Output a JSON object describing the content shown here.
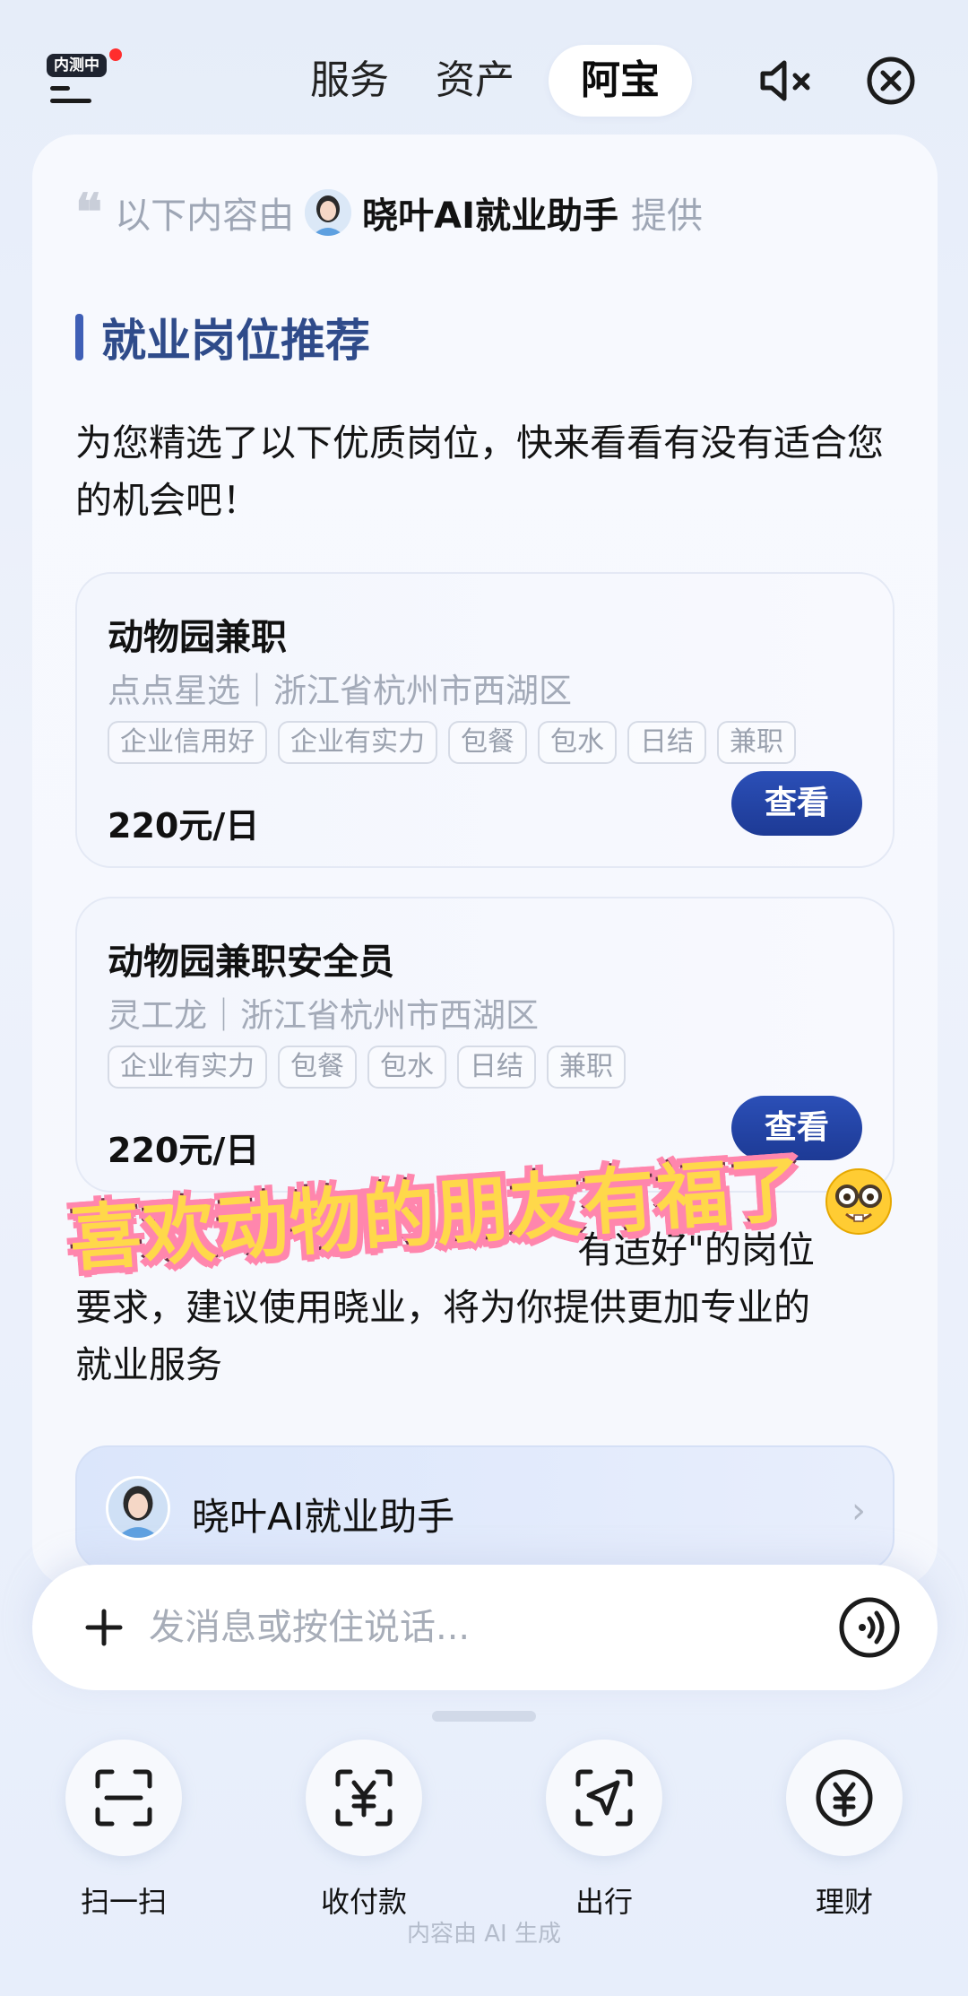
{
  "header": {
    "beta_badge": "内测中",
    "tabs": [
      {
        "label": "服务"
      },
      {
        "label": "资产"
      },
      {
        "label": "阿宝"
      }
    ]
  },
  "provider": {
    "prefix": "以下内容由",
    "name": "晓叶AI就业助手",
    "suffix": "提供"
  },
  "section": {
    "title": "就业岗位推荐",
    "intro": "为您精选了以下优质岗位，快来看看有没有适合您的机会吧！"
  },
  "jobs": [
    {
      "title": "动物园兼职",
      "meta": "点点星选｜浙江省杭州市西湖区",
      "tags": [
        "企业信用好",
        "企业有实力",
        "包餐",
        "包水",
        "日结",
        "兼职"
      ],
      "salary": "220元/日",
      "button": "查看"
    },
    {
      "title": "动物园兼职安全员",
      "meta": "灵工龙｜浙江省杭州市西湖区",
      "tags": [
        "企业有实力",
        "包餐",
        "包水",
        "日结",
        "兼职"
      ],
      "salary": "220元/日",
      "button": "查看"
    }
  ],
  "tail": {
    "line1_tail": "有适好\"的岗位",
    "line2": "要求，建议使用晓业，将为你提供更加专业的",
    "line3": "就业服务"
  },
  "sticker": {
    "text": "喜欢动物的朋友有福了"
  },
  "assistant": {
    "name": "晓叶AI就业助手"
  },
  "input": {
    "placeholder": "发消息或按住说话..."
  },
  "shortcuts": [
    {
      "label": "扫一扫",
      "icon": "scan-icon"
    },
    {
      "label": "收付款",
      "icon": "payment-icon"
    },
    {
      "label": "出行",
      "icon": "travel-icon"
    },
    {
      "label": "理财",
      "icon": "finance-icon"
    }
  ],
  "footer": {
    "note": "内容由 AI 生成"
  },
  "colors": {
    "accent": "#2b4fb7",
    "section_title": "#2f4b8a",
    "sticker_fill": "#ffd84a",
    "sticker_outline": "#ff86ad"
  }
}
